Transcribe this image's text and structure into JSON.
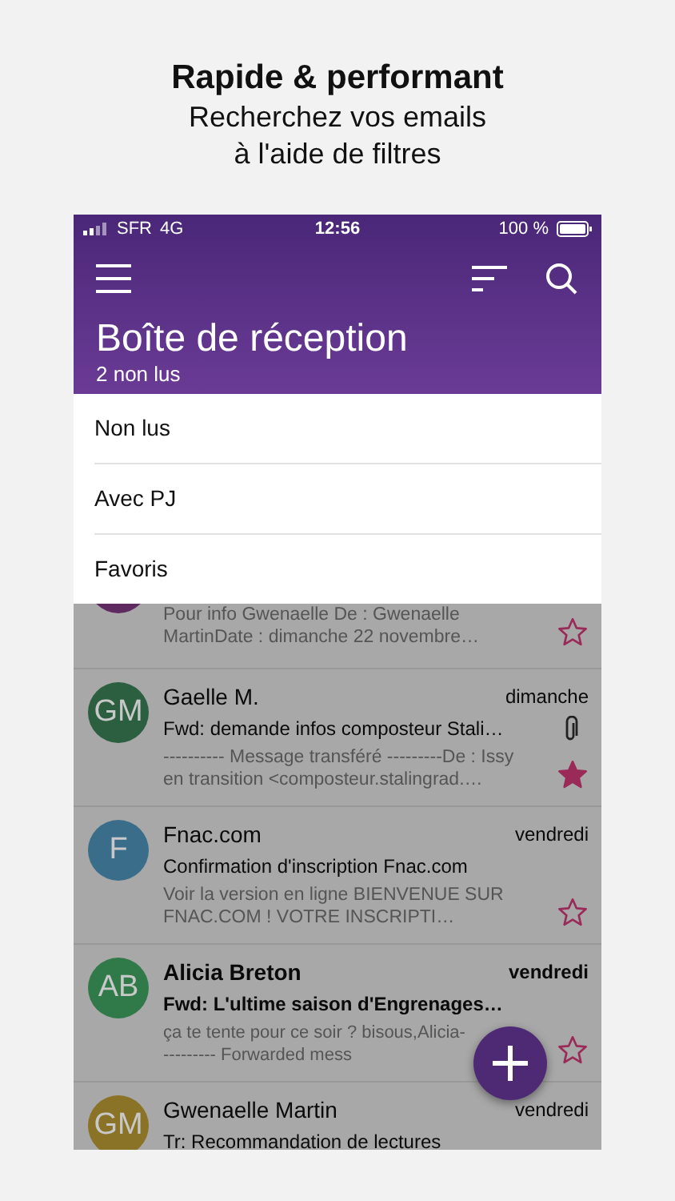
{
  "promo": {
    "title": "Rapide & performant",
    "subtitle_lines": [
      "Recherchez vos emails",
      "à l'aide de filtres"
    ]
  },
  "status_bar": {
    "carrier": "SFR",
    "network": "4G",
    "time": "12:56",
    "battery": "100 %"
  },
  "header": {
    "title": "Boîte de réception",
    "subtitle": "2 non lus"
  },
  "filter_menu": [
    {
      "label": "Non lus"
    },
    {
      "label": "Avec PJ"
    },
    {
      "label": "Favoris"
    }
  ],
  "messages": [
    {
      "preview": "Pour info Gwenaelle De : Gwenaelle MartinDate : dimanche 22 novembre…",
      "starred": false,
      "attachment": false,
      "color": "#5e2a60"
    },
    {
      "initials": "GM",
      "color": "#2c5e40",
      "sender": "Gaelle M.",
      "date": "dimanche",
      "subject": "Fwd: demande infos composteur Stali…",
      "preview": "---------- Message transféré ---------De : Issy en transition <composteur.stalingrad.…",
      "unread": false,
      "starred": true,
      "attachment": true
    },
    {
      "initials": "F",
      "color": "#3a6d8a",
      "sender": "Fnac.com",
      "date": "vendredi",
      "subject": "Confirmation d'inscription Fnac.com",
      "preview": "Voir la version en ligne  BIENVENUE SUR FNAC.COM !     VOTRE INSCRIPTI…",
      "unread": false,
      "starred": false,
      "attachment": false
    },
    {
      "initials": "AB",
      "color": "#2f7a48",
      "sender": "Alicia Breton",
      "date": "vendredi",
      "subject": "Fwd: L'ultime saison d'Engrenages…",
      "preview": "ça te tente pour ce soir ? bisous,Alicia---------- Forwarded mess",
      "unread": true,
      "starred": false,
      "attachment": false
    },
    {
      "initials": "GM",
      "color": "#8a7226",
      "sender": "Gwenaelle Martin",
      "date": "vendredi",
      "subject": "Tr: Recommandation de lectures",
      "unread": false,
      "attachment": false
    }
  ]
}
